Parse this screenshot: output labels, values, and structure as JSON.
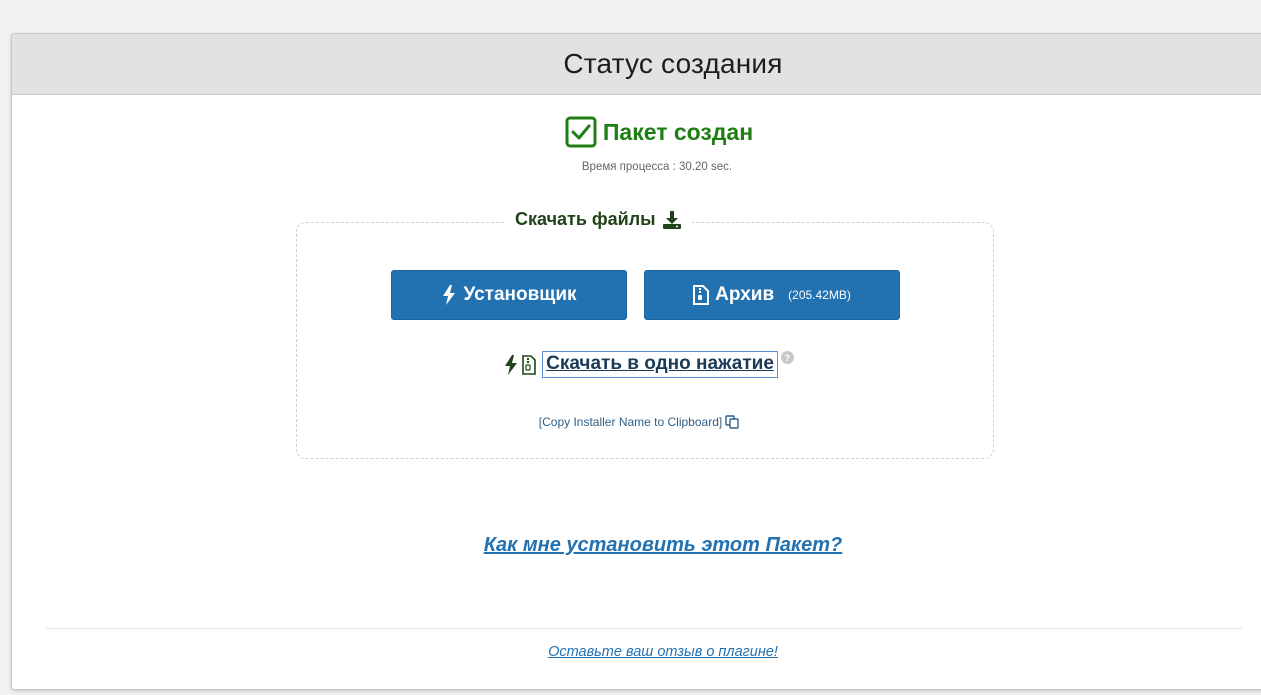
{
  "panel": {
    "title": "Статус создания"
  },
  "status": {
    "text": "Пакет создан",
    "process_time": "Время процесса : 30.20 sec.",
    "color": "#1e7d13"
  },
  "download": {
    "legend": "Скачать файлы",
    "installer_button": "Установщик",
    "archive_button": "Архив",
    "archive_size": "(205.42MB)",
    "one_click_link": "Скачать в одно нажатие",
    "help_glyph": "?",
    "copy_installer_link": "[Copy Installer Name to Clipboard]",
    "button_color": "#2271b1"
  },
  "links": {
    "how_to_install": "Как мне установить этот Пакет?",
    "feedback": "Оставьте ваш отзыв о плагине!"
  },
  "icons": {
    "status": "check-square-icon",
    "legend": "download-icon",
    "installer": "bolt-icon",
    "archive": "file-archive-icon",
    "copy": "copy-icon",
    "help": "help-icon"
  }
}
